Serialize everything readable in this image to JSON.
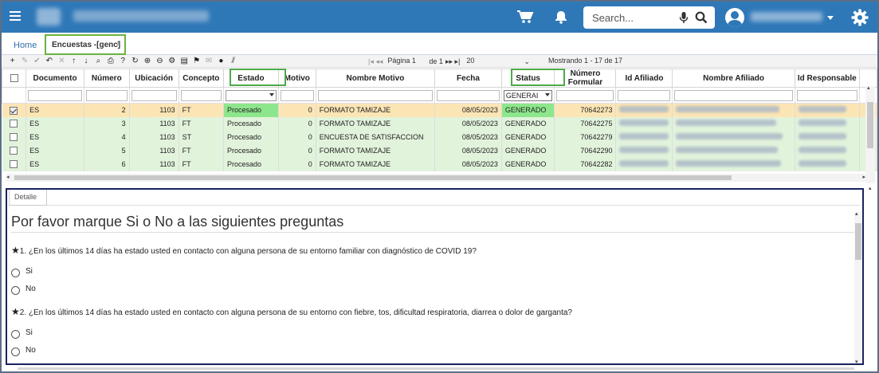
{
  "topbar": {
    "search_placeholder": "Search...",
    "accent": "#2f78b8"
  },
  "tabs": {
    "home": "Home",
    "active": "Encuestas -[genc]",
    "close": "×"
  },
  "toolbar": {
    "icons": [
      "plus-icon",
      "pencil-icon",
      "check-icon",
      "undo-icon",
      "cross-icon",
      "arrow-up-icon",
      "arrow-down-icon",
      "search-icon",
      "print-icon",
      "help-icon",
      "refresh-icon",
      "zoom-in-icon",
      "zoom-out-icon",
      "settings-icon",
      "bookmark-icon",
      "pin-icon",
      "mail-icon",
      "info-icon",
      "column-resize-icon"
    ],
    "page_label": "Página 1",
    "of_label": "de 1",
    "page_size": "20",
    "showing": "Mostrando 1 - 17 de 17"
  },
  "grid": {
    "columns": [
      "Documento",
      "Número",
      "Ubicación",
      "Concepto",
      "Estado",
      "Motivo",
      "Nombre Motivo",
      "Fecha",
      "Status",
      "Número Formular",
      "Id Afiliado",
      "Nombre Afiliado",
      "Id Responsable"
    ],
    "filter_status": "GENERAI",
    "rows": [
      {
        "doc": "ES",
        "num": "2",
        "ubic": "1103",
        "conc": "FT",
        "estado": "Procesado",
        "motivo": "0",
        "nombre": "FORMATO TAMIZAJE",
        "fecha": "08/05/2023",
        "status": "GENERADO",
        "form": "70642273"
      },
      {
        "doc": "ES",
        "num": "3",
        "ubic": "1103",
        "conc": "FT",
        "estado": "Procesado",
        "motivo": "0",
        "nombre": "FORMATO TAMIZAJE",
        "fecha": "08/05/2023",
        "status": "GENERADO",
        "form": "70642275"
      },
      {
        "doc": "ES",
        "num": "4",
        "ubic": "1103",
        "conc": "ST",
        "estado": "Procesado",
        "motivo": "0",
        "nombre": "ENCUESTA DE SATISFACCION",
        "fecha": "08/05/2023",
        "status": "GENERADO",
        "form": "70642279"
      },
      {
        "doc": "ES",
        "num": "5",
        "ubic": "1103",
        "conc": "FT",
        "estado": "Procesado",
        "motivo": "0",
        "nombre": "FORMATO TAMIZAJE",
        "fecha": "08/05/2023",
        "status": "GENERADO",
        "form": "70642290"
      },
      {
        "doc": "ES",
        "num": "6",
        "ubic": "1103",
        "conc": "FT",
        "estado": "Procesado",
        "motivo": "0",
        "nombre": "FORMATO TAMIZAJE",
        "fecha": "08/05/2023",
        "status": "GENERADO",
        "form": "70642282"
      }
    ]
  },
  "detail": {
    "tab": "Detalle",
    "title": "Por favor marque Si o No a las siguientes preguntas",
    "questions": [
      {
        "marker": "★",
        "text": "1. ¿En los últimos 14 días ha estado usted en contacto con alguna persona de su entorno familiar con diagnóstico de COVID 19?",
        "opt_yes": "Si",
        "opt_no": "No"
      },
      {
        "marker": "★",
        "text": "2. ¿En los últimos 14 días ha estado usted en contacto con alguna persona de su entorno con fiebre, tos, dificultad respiratoria, diarrea o dolor de garganta?",
        "opt_yes": "Si",
        "opt_no": "No"
      }
    ]
  }
}
